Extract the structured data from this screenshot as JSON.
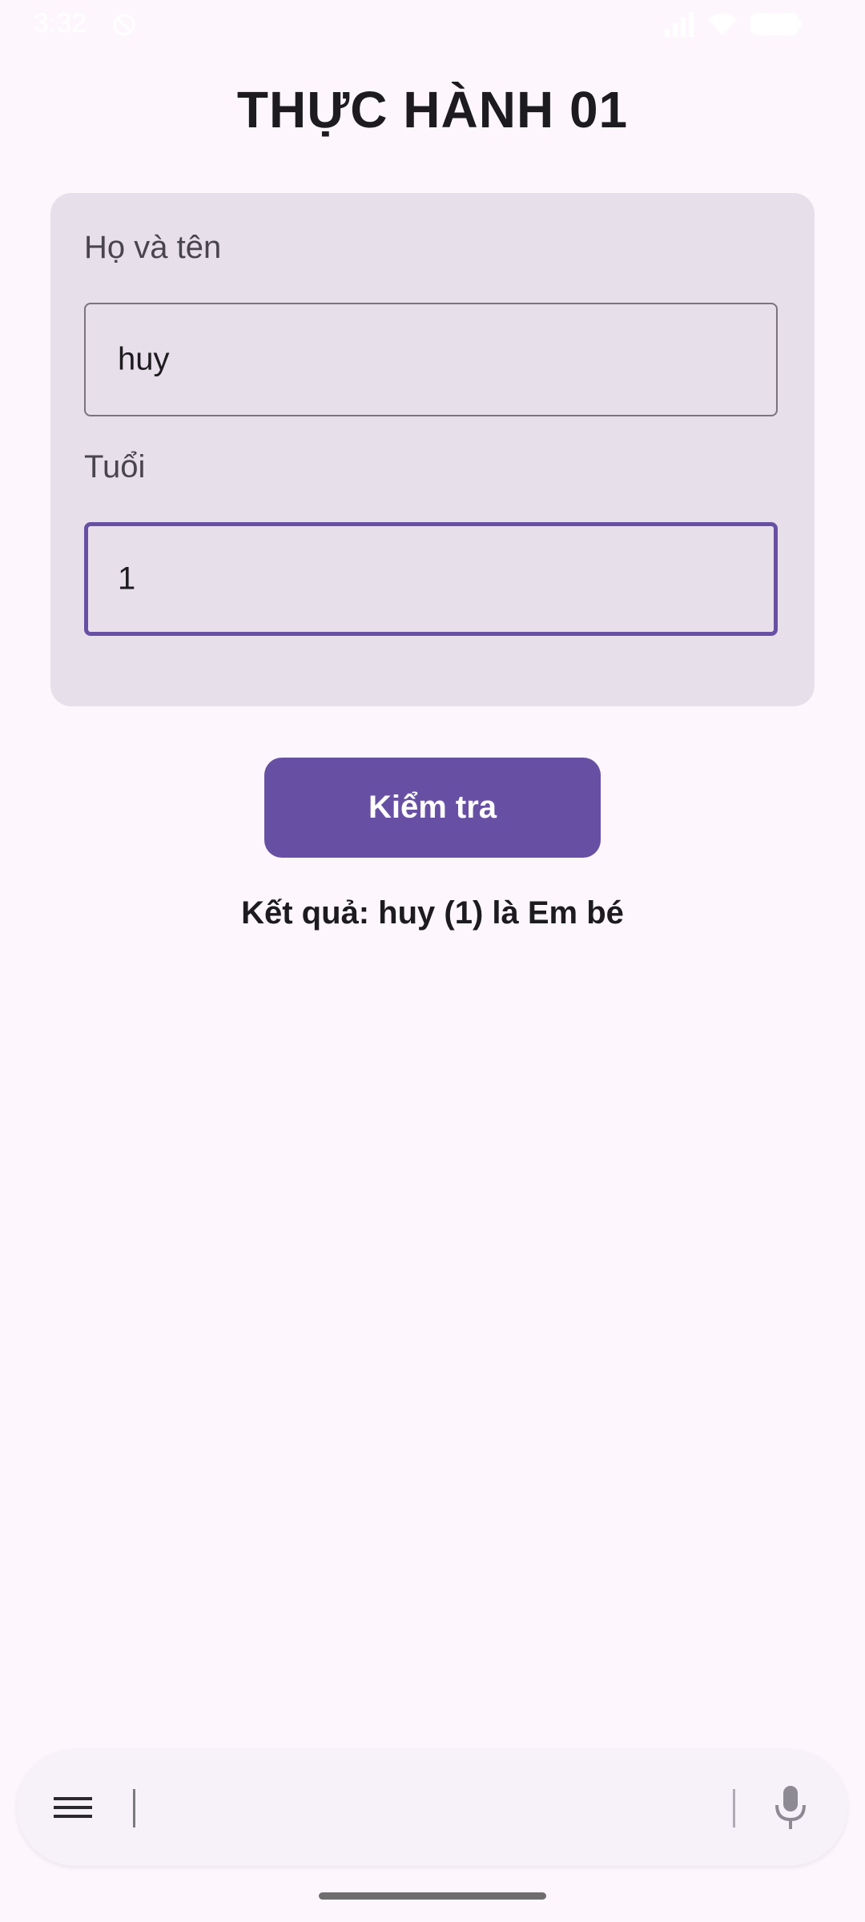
{
  "status_bar": {
    "time": "3:32"
  },
  "page": {
    "title": "THỰC HÀNH 01"
  },
  "form": {
    "name_label": "Họ và tên",
    "name_value": "huy",
    "age_label": "Tuổi",
    "age_value": "1"
  },
  "actions": {
    "check_label": "Kiểm tra"
  },
  "result": {
    "text": "Kết quả: huy (1) là Em bé"
  },
  "bottom_bar": {
    "menu_icon": "hamburger-menu-icon",
    "mic_icon": "microphone-icon"
  },
  "colors": {
    "background": "#FDF7FD",
    "card": "#E7DFEA",
    "primary": "#6750A4",
    "text": "#1D1B20",
    "label": "#49454F"
  }
}
